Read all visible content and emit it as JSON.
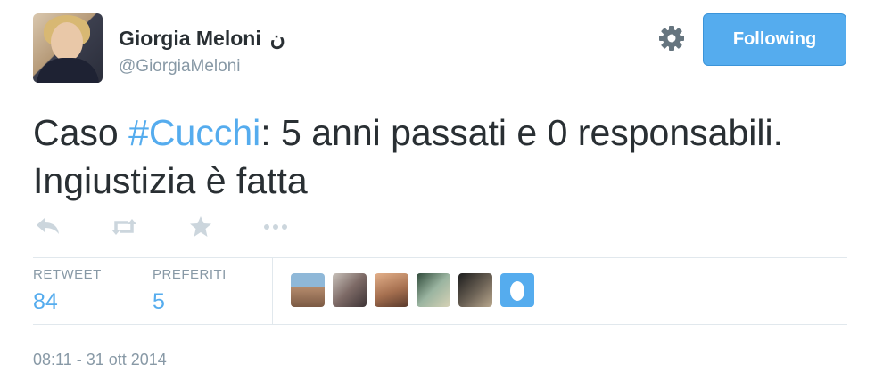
{
  "user": {
    "name": "Giorgia Meloni",
    "badge": "ن",
    "handle": "@GiorgiaMeloni"
  },
  "buttons": {
    "follow_label": "Following",
    "settings_icon": "gear-icon"
  },
  "tweet": {
    "text_before": "Caso ",
    "hashtag": "#Cucchi",
    "text_after": ": 5 anni passati e 0 responsabili. Ingiustizia è fatta"
  },
  "actions": [
    "reply-icon",
    "retweet-icon",
    "favorite-icon",
    "more-icon"
  ],
  "stats": {
    "retweet_label": "RETWEET",
    "retweet_count": "84",
    "favorites_label": "PREFERITI",
    "favorites_count": "5"
  },
  "timestamp": "08:11 - 31 ott 2014",
  "colors": {
    "accent": "#55acee",
    "text": "#292f33",
    "muted": "#8899a6",
    "divider": "#e1e8ed"
  }
}
